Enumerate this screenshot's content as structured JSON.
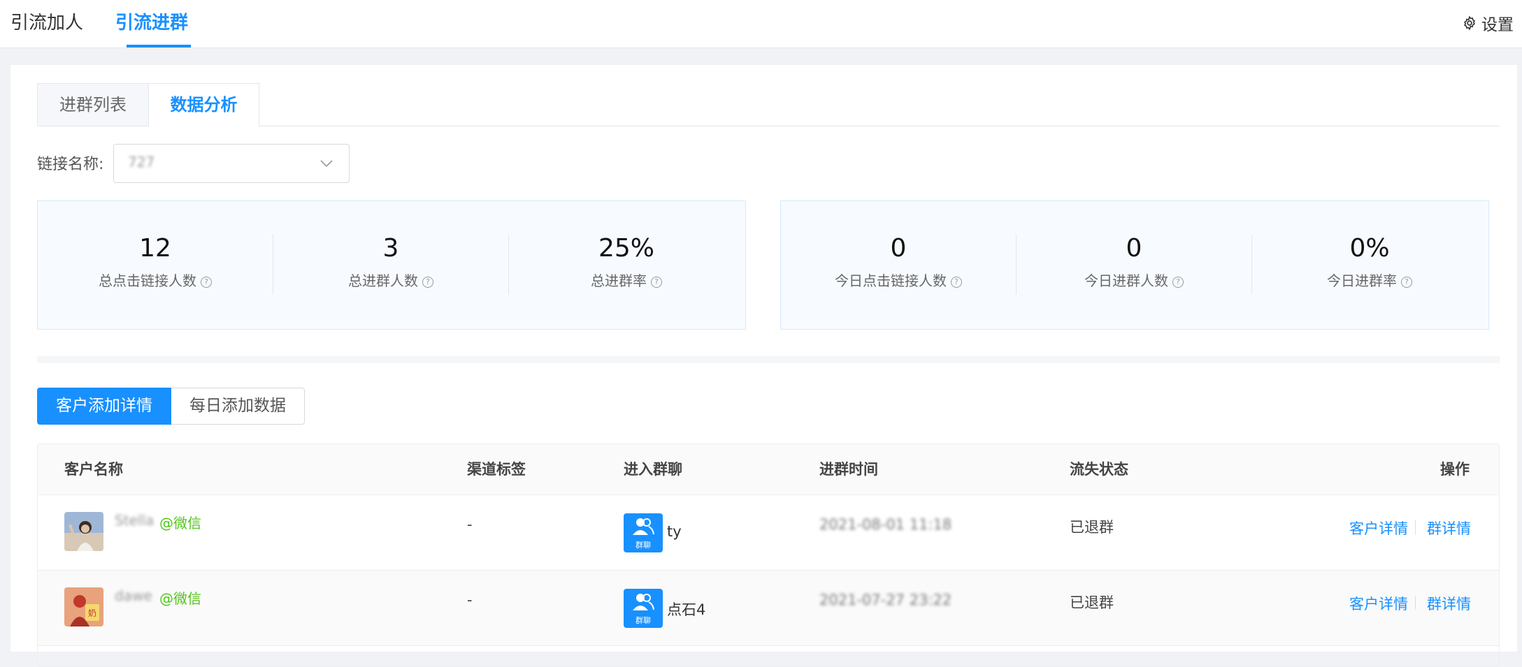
{
  "top_nav": {
    "items": [
      "引流加人",
      "引流进群"
    ],
    "active": "引流进群",
    "settings_label": "设置"
  },
  "tabs": {
    "items": [
      "进群列表",
      "数据分析"
    ],
    "active": "数据分析"
  },
  "filter": {
    "link_name_label": "链接名称:",
    "link_name_value": "727"
  },
  "stats_total": [
    {
      "value": "12",
      "label": "总点击链接人数"
    },
    {
      "value": "3",
      "label": "总进群人数"
    },
    {
      "value": "25%",
      "label": "总进群率"
    }
  ],
  "stats_today": [
    {
      "value": "0",
      "label": "今日点击链接人数"
    },
    {
      "value": "0",
      "label": "今日进群人数"
    },
    {
      "value": "0%",
      "label": "今日进群率"
    }
  ],
  "segments": {
    "items": [
      "客户添加详情",
      "每日添加数据"
    ],
    "active": "客户添加详情"
  },
  "table": {
    "headers": [
      "客户名称",
      "渠道标签",
      "进入群聊",
      "进群时间",
      "流失状态",
      "操作"
    ],
    "rows": [
      {
        "name": "Stella",
        "source": "@微信",
        "channel": "-",
        "group_icon_label": "群聊",
        "group": "ty",
        "time": "2021-08-01 11:18",
        "status": "已退群",
        "action1": "客户详情",
        "action2": "群详情"
      },
      {
        "name": "dawe",
        "source": "@微信",
        "channel": "-",
        "group_icon_label": "群聊",
        "group": "点石4",
        "time": "2021-07-27 23:22",
        "status": "已退群",
        "action1": "客户详情",
        "action2": "群详情"
      }
    ]
  },
  "icons": {
    "settings": "gear-icon",
    "dropdown": "chevron-down-icon",
    "help": "question-circle-icon",
    "group": "group-chat-icon"
  },
  "colors": {
    "accent": "#1890ff",
    "wechat_green": "#52c41a"
  }
}
